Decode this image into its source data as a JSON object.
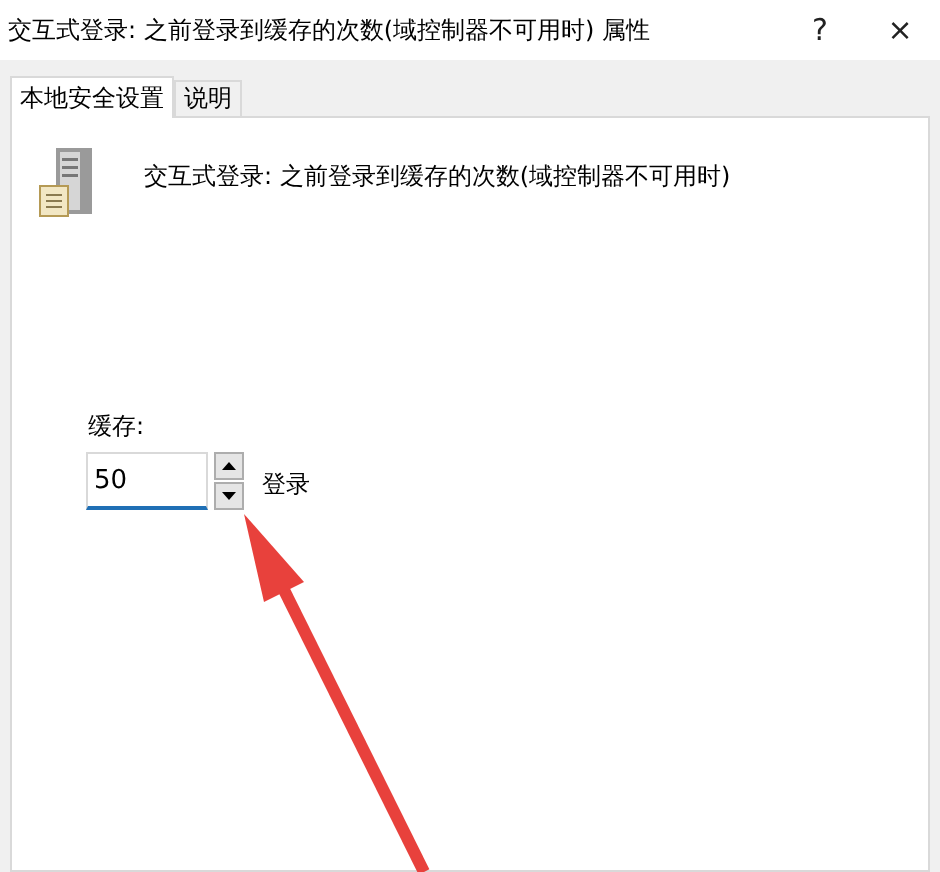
{
  "window": {
    "title": "交互式登录: 之前登录到缓存的次数(域控制器不可用时) 属性",
    "help": "?",
    "close": "×"
  },
  "tabs": [
    {
      "label": "本地安全设置",
      "selected": true
    },
    {
      "label": "说明",
      "selected": false
    }
  ],
  "setting": {
    "heading": "交互式登录: 之前登录到缓存的次数(域控制器不可用时)",
    "field_label": "缓存:",
    "value": "50",
    "unit": "登录"
  }
}
